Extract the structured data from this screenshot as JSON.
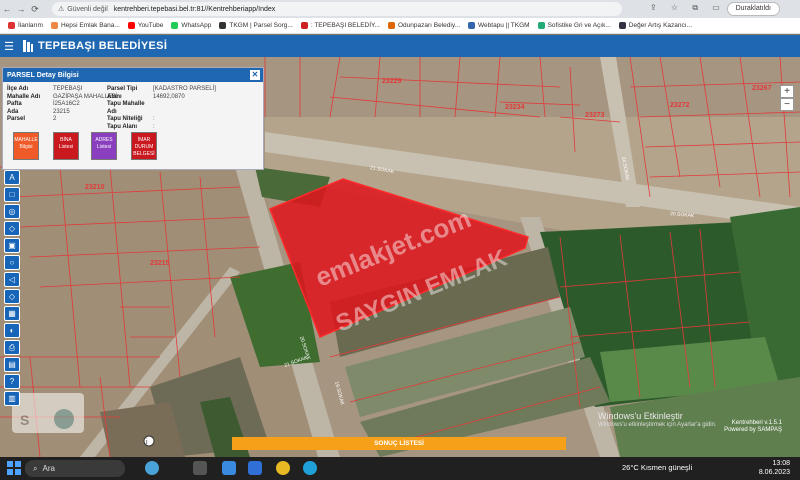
{
  "browser": {
    "secure_label": "Güvenli değil",
    "url": "kentrehberi.tepebasi.bel.tr:81//Kentrehberiapp/Index",
    "paused_label": "Duraklatıldı",
    "bookmarks": [
      {
        "label": "İlanlarım",
        "color": "#d33"
      },
      {
        "label": "Hepsi Emlak Bana...",
        "color": "#e84"
      },
      {
        "label": "YouTube",
        "color": "#f00"
      },
      {
        "label": "WhatsApp",
        "color": "#2c5"
      },
      {
        "label": "TKGM | Parsel Sorg...",
        "color": "#333"
      },
      {
        "label": ": TEPEBAŞI BELEDİY...",
        "color": "#c22"
      },
      {
        "label": "Odunpazarı Belediy...",
        "color": "#d60"
      },
      {
        "label": "Webtapu || TKGM",
        "color": "#36a"
      },
      {
        "label": "Sofistike Gri ve Açık...",
        "color": "#2a7"
      },
      {
        "label": "Değer Artış Kazancı...",
        "color": "#334"
      }
    ]
  },
  "app": {
    "title": "TEPEBAŞI BELEDİYESİ"
  },
  "panel": {
    "title": "PARSEL Detay Bilgisi",
    "left": [
      {
        "k": "İlçe Adı",
        "v": "TEPEBAŞI"
      },
      {
        "k": "Mahalle Adı",
        "v": "GAZİPAŞA MAHALLESİ"
      },
      {
        "k": "Pafta",
        "v": "İ25A16C2"
      },
      {
        "k": "Ada",
        "v": "23215"
      },
      {
        "k": "Parsel",
        "v": "2"
      }
    ],
    "right": [
      {
        "k": "Parsel Tipi",
        "v": "[KADASTRO PARSELİ]"
      },
      {
        "k": "Alanı",
        "v": "14692,0870"
      },
      {
        "k": "Tapu Mahalle Adı",
        "v": ""
      },
      {
        "k": "Tapu Niteliği",
        "v": ":"
      },
      {
        "k": "Tapu Alanı",
        "v": ":"
      }
    ],
    "buttons": [
      {
        "label": "MAHALLE Bilgisi",
        "color": "#f05a28"
      },
      {
        "label": "BİNA Listesi",
        "color": "#c9181e"
      },
      {
        "label": "ADRES Listesi",
        "color": "#8a3fbf"
      },
      {
        "label": "İMAR DURUM BELGESİ",
        "color": "#c9181e"
      }
    ]
  },
  "map": {
    "parcel_labels": [
      "23229",
      "23234",
      "23273",
      "23272",
      "23267",
      "23210",
      "23215"
    ],
    "street_labels": [
      "21.SOKAK",
      "20.SOKAK",
      "24.SOKAK",
      "19.SOKAK",
      "21.SOKAK",
      "20.SOKAK"
    ],
    "highlight_color": "#e0141c",
    "watermark": [
      "emlakjet.com",
      "SAYGIN EMLAK"
    ]
  },
  "tools": [
    "A",
    "□",
    "◎",
    "◇",
    "▣",
    "○",
    "◁",
    "◇",
    "▦",
    "◐",
    "⎙",
    "▤",
    "?",
    "▥"
  ],
  "result_bar": "SONUÇ LİSTESİ",
  "win_activation": {
    "line1": "Windows'u Etkinleştir",
    "line2": "Windows'u etkinleştirmek için Ayarlar'a gidin."
  },
  "kent": {
    "line1": "Kentrehberi v.1.5.1",
    "line2": "Powered by SAMPAŞ"
  },
  "taskbar": {
    "search": "Ara",
    "weather": "26°C  Kısmen güneşli",
    "time": "13:08",
    "date": "8.06.2023"
  }
}
